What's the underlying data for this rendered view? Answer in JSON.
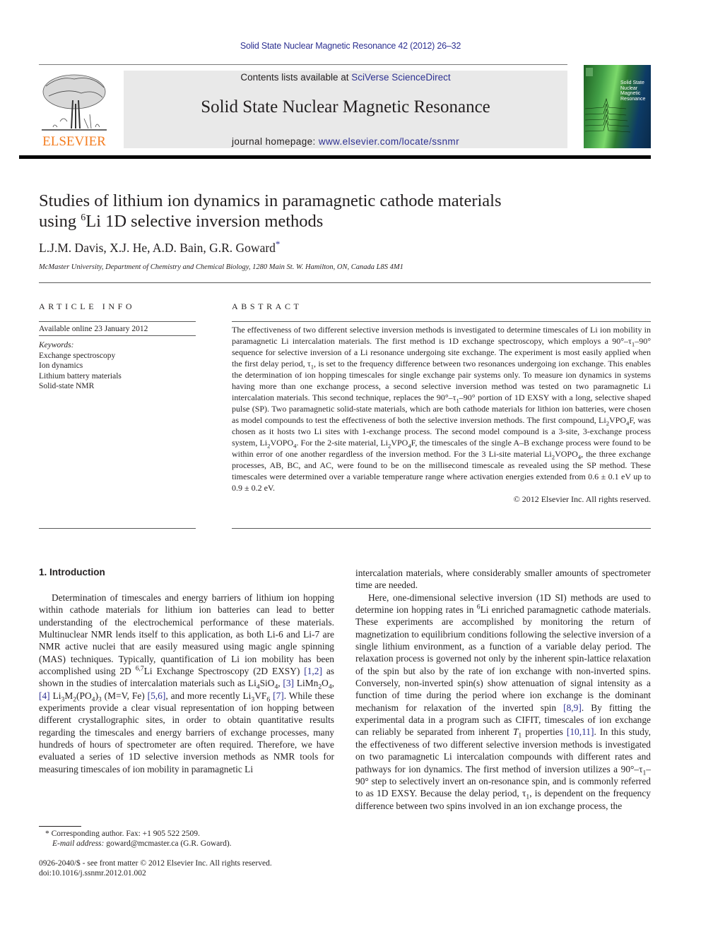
{
  "header": {
    "running_head": "Solid State Nuclear Magnetic Resonance 42 (2012) 26–32",
    "publisher_logo_text": "ELSEVIER",
    "contents_prefix": "Contents lists available at ",
    "contents_link": "SciVerse ScienceDirect",
    "journal_name": "Solid State Nuclear Magnetic Resonance",
    "homepage_prefix": "journal homepage: ",
    "homepage_link": "www.elsevier.com/locate/ssnmr",
    "cover_title_lines": [
      "Solid State",
      "Nuclear",
      "Magnetic",
      "Resonance"
    ]
  },
  "article": {
    "title_line1": "Studies of lithium ion dynamics in paramagnetic cathode materials",
    "title_line2_pre": "using ",
    "title_line2_sup": "6",
    "title_line2_post": "Li 1D selective inversion methods",
    "authors": "L.J.M. Davis, X.J. He, A.D. Bain, G.R. Goward",
    "author_mark": "*",
    "affiliation": "McMaster University, Department of Chemistry and Chemical Biology, 1280 Main St. W. Hamilton, ON, Canada L8S 4M1"
  },
  "article_info": {
    "heading": "ARTICLE INFO",
    "available_online": "Available online 23 January 2012",
    "keywords_label": "Keywords:",
    "keywords": [
      "Exchange spectroscopy",
      "Ion dynamics",
      "Lithium battery materials",
      "Solid-state NMR"
    ]
  },
  "abstract": {
    "heading": "ABSTRACT",
    "p1": "The effectiveness of two different selective inversion methods is investigated to determine timescales of Li ion mobility in paramagnetic Li intercalation materials. The first method is 1D exchange spectroscopy, which employs a 90°–τ",
    "p1_sub": "1",
    "p2": "–90° sequence for selective inversion of a Li resonance undergoing site exchange. The experiment is most easily applied when the first delay period, τ",
    "p2_sub": "1",
    "p3": ", is set to the frequency difference between two resonances undergoing ion exchange. This enables the determination of ion hopping timescales for single exchange pair systems only. To measure ion dynamics in systems having more than one exchange process, a second selective inversion method was tested on two paramagnetic Li intercalation materials. This second technique, replaces the 90°–τ",
    "p3_sub": "1",
    "p4": "–90° portion of 1D EXSY with a long, selective shaped pulse (SP). Two paramagnetic solid-state materials, which are both cathode materials for lithion ion batteries, were chosen as model compounds to test the effectiveness of both the selective inversion methods. The first compound, Li",
    "p4_sub": "2",
    "p5": "VPO",
    "p5_sub": "4",
    "p6": "F, was chosen as it hosts two Li sites with 1-exchange process. The second model compound is a 3-site, 3-exchange process system, Li",
    "p6_sub": "2",
    "p7": "VOPO",
    "p7_sub": "4",
    "p8": ". For the 2-site material, Li",
    "p8_sub": "2",
    "p9": "VPO",
    "p9_sub": "4",
    "p10": "F, the timescales of the single A–B exchange process were found to be within error of one another regardless of the inversion method. For the 3 Li-site material Li",
    "p10_sub": "2",
    "p11": "VOPO",
    "p11_sub": "4",
    "p12": ", the three exchange processes, AB, BC, and AC, were found to be on the millisecond timescale as revealed using the SP method. These timescales were determined over a variable temperature range where activation energies extended from 0.6 ± 0.1 eV up to 0.9 ± 0.2 eV.",
    "copyright": "© 2012 Elsevier Inc. All rights reserved."
  },
  "body": {
    "section_heading": "1.  Introduction",
    "left": {
      "a": "Determination of timescales and energy barriers of lithium ion hopping within cathode materials for lithium ion batteries can lead to better understanding of the electrochemical performance of these materials. Multinuclear NMR lends itself to this application, as both Li-6 and Li-7 are NMR active nuclei that are easily measured using magic angle spinning (MAS) techniques. Typically, quantification of Li ion mobility has been accomplished using 2D ",
      "sup67": "6,7",
      "b": "Li Exchange Spectroscopy (2D EXSY) ",
      "ref12": "[1,2]",
      "c": " as shown in the studies of intercalation materials such as Li",
      "s4": "4",
      "d": "SiO",
      "s4b": "4",
      "e": ", ",
      "ref3": "[3]",
      "f": " LiMn",
      "s2": "2",
      "g": "O",
      "s4c": "4",
      "h": ", ",
      "ref4": "[4]",
      "i": " Li",
      "s3": "3",
      "j": "M",
      "s2b": "2",
      "k": "(PO",
      "s4d": "4",
      "l": ")",
      "s3b": "3",
      "m": " (M=V, Fe) ",
      "ref56": "[5,6]",
      "n": ", and more recently Li",
      "s3c": "3",
      "o": "VF",
      "s6": "6",
      "p": " ",
      "ref7": "[7]",
      "q": ". While these experiments provide a clear visual representation of ion hopping between different crystallographic sites, in order to obtain quantitative results regarding the timescales and energy barriers of exchange processes, many hundreds of hours of spectrometer are often required. Therefore, we have evaluated a series of 1D selective inversion methods as NMR tools for measuring timescales of ion mobility in paramagnetic Li"
    },
    "right": {
      "cont": "intercalation materials, where considerably smaller amounts of spectrometer time are needed.",
      "a": "Here, one-dimensional selective inversion (1D SI) methods are used to determine ion hopping rates in ",
      "sup6": "6",
      "b": "Li enriched paramagnetic cathode materials. These experiments are accomplished by monitoring the return of magnetization to equilibrium conditions following the selective inversion of a single lithium environment, as a function of a variable delay period. The relaxation process is governed not only by the inherent spin-lattice relaxation of the spin but also by the rate of ion exchange with non-inverted spins. Conversely, non-inverted spin(s) show attenuation of signal intensity as a function of time during the period where ion exchange is the dominant mechanism for relaxation of the inverted spin ",
      "ref89": "[8,9]",
      "c": ". By fitting the experimental data in a program such as CIFIT, timescales of ion exchange can reliably be separated from inherent ",
      "T": "T",
      "T_sub": "1",
      "d": " properties ",
      "ref1011": "[10,11]",
      "e": ". In this study, the effectiveness of two different selective inversion methods is investigated on two paramagnetic Li intercalation compounds with different rates and pathways for ion dynamics. The first method of inversion utilizes a 90°–τ",
      "e_sub": "1",
      "f": "–90° step to selectively invert an on-resonance spin, and is commonly referred to as 1D EXSY. Because the delay period, τ",
      "f_sub": "1",
      "g": ", is dependent on the frequency difference between two spins involved in an ion exchange process, the"
    }
  },
  "footnotes": {
    "mark": "*",
    "corresponding": " Corresponding author. Fax: +1 905 522 2509.",
    "email_label": "E-mail address:",
    "email": " goward@mcmaster.ca (G.R. Goward).",
    "issn": "0926-2040/$ - see front matter © 2012 Elsevier Inc. All rights reserved.",
    "doi": "doi:10.1016/j.ssnmr.2012.01.002"
  }
}
